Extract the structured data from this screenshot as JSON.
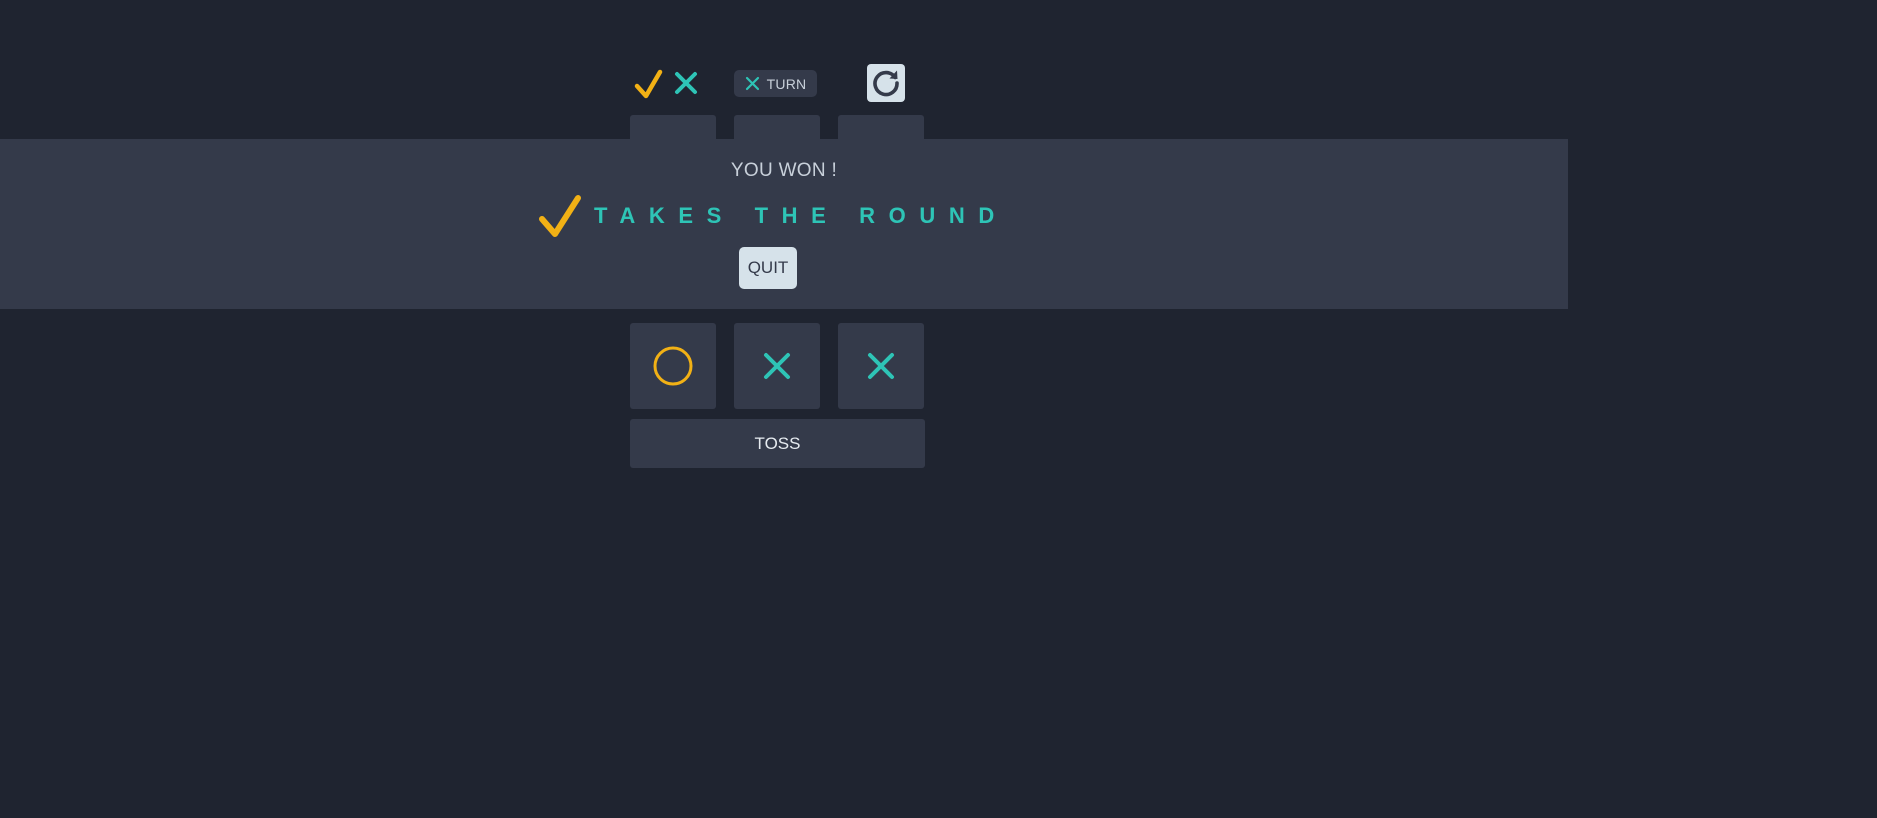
{
  "header": {
    "logo_icons": [
      "check-mark-icon",
      "x-mark-icon"
    ],
    "turn": {
      "mark_icon": "x-mark-icon",
      "label": "TURN"
    },
    "restart_icon": "restart-icon"
  },
  "board": {
    "rows": [
      [
        {
          "mark": "",
          "hidden_behind_banner": true
        },
        {
          "mark": "",
          "hidden_behind_banner": true
        },
        {
          "mark": "",
          "hidden_behind_banner": true
        }
      ],
      [
        {
          "mark": "o"
        },
        {
          "mark": "x"
        },
        {
          "mark": "x"
        }
      ]
    ]
  },
  "result": {
    "title": "YOU WON !",
    "winner_icon": "check-mark-icon",
    "message": "TAKES THE ROUND",
    "quit_label": "QUIT"
  },
  "toss": {
    "label": "TOSS"
  },
  "colors": {
    "background": "#1f2430",
    "surface": "#343a4a",
    "light_button": "#d6e2ea",
    "orange": "#f2b115",
    "teal": "#2ec4b6"
  }
}
